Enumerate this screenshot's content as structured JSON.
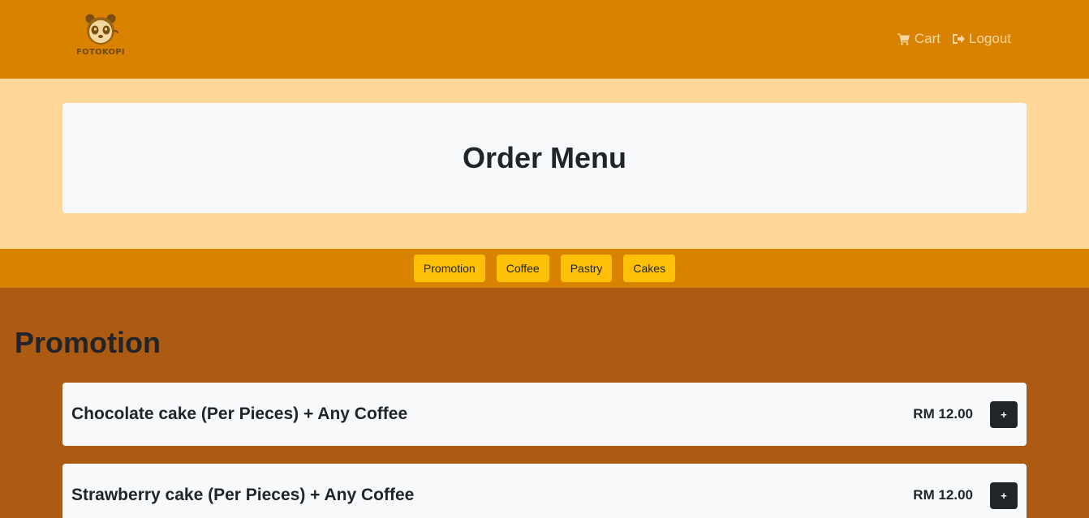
{
  "brand": {
    "name": "FOTOKOPI",
    "logo_icon": "panda-icon"
  },
  "nav": {
    "cart_label": "Cart",
    "logout_label": "Logout"
  },
  "hero": {
    "title": "Order Menu"
  },
  "categories": [
    "Promotion",
    "Coffee",
    "Pastry",
    "Cakes"
  ],
  "section": {
    "title": "Promotion",
    "items": [
      {
        "name": "Chocolate cake (Per Pieces) + Any Coffee",
        "price": "RM 12.00",
        "add_label": "+"
      },
      {
        "name": "Strawberry cake (Per Pieces) + Any Coffee",
        "price": "RM 12.00",
        "add_label": "+"
      }
    ]
  },
  "colors": {
    "navbar": "#d98200",
    "hero": "#ffd899",
    "content": "#ad5b13",
    "category_button": "#ffc107",
    "card": "#f8f9fa",
    "add_button": "#212529"
  }
}
